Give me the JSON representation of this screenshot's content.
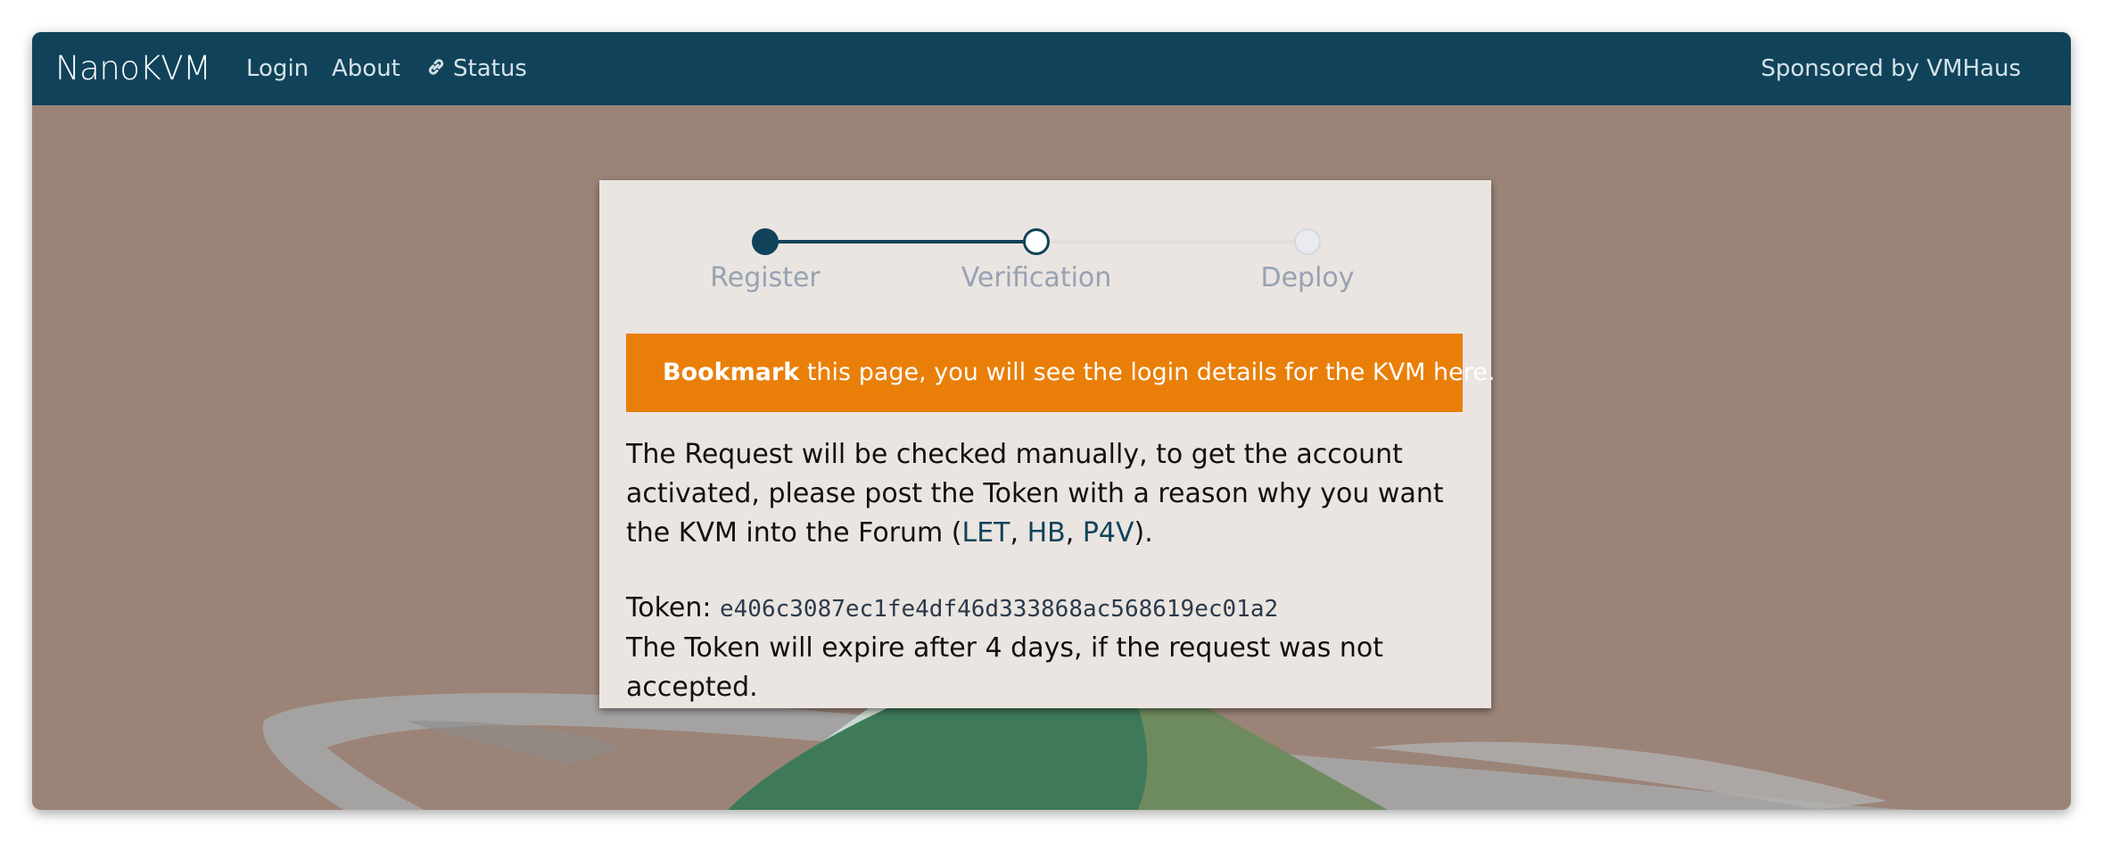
{
  "navbar": {
    "brand": "NanoKVM",
    "links": [
      {
        "label": "Login"
      },
      {
        "label": "About"
      },
      {
        "label": "Status",
        "icon": "link-icon"
      }
    ],
    "sponsor": "Sponsored by VMHaus"
  },
  "steps": [
    {
      "label": "Register",
      "state": "done"
    },
    {
      "label": "Verification",
      "state": "active"
    },
    {
      "label": "Deploy",
      "state": "pending"
    }
  ],
  "alert": {
    "bold": "Bookmark",
    "text": " this page, you will see the login details for the KVM here."
  },
  "message": {
    "line_start": "The Request will be checked manually, to get the account activated, please post the Token with a reason why you want the KVM into the Forum (",
    "links": [
      "LET",
      "HB",
      "P4V"
    ],
    "line_end": ")."
  },
  "token": {
    "label": "Token: ",
    "value": "e406c3087ec1fe4df46d333868ac568619ec01a2",
    "expiry": "The Token will expire after 4 days, if the request was not accepted."
  },
  "colors": {
    "navbar": "#10435a",
    "background": "#9b8477",
    "card": "#eae5e1",
    "alert": "#e97f08",
    "link": "#10435a"
  }
}
